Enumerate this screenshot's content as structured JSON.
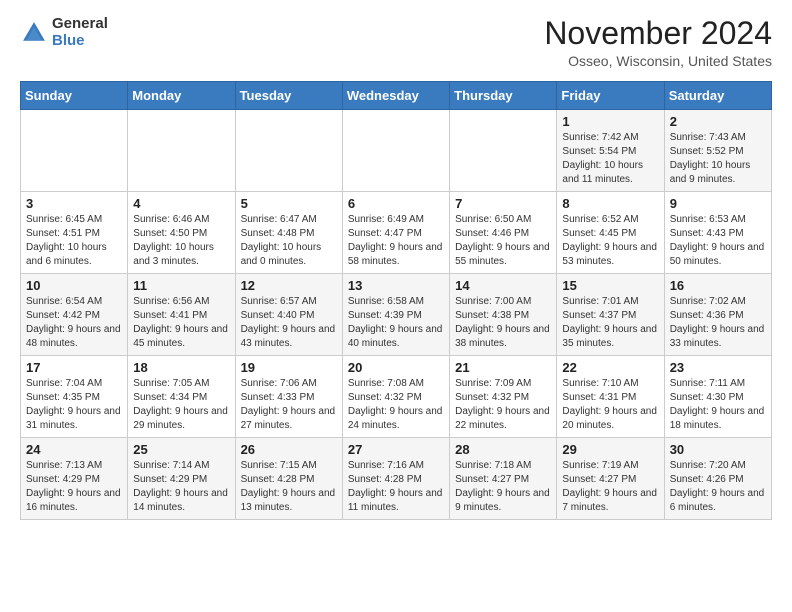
{
  "logo": {
    "general": "General",
    "blue": "Blue"
  },
  "title": "November 2024",
  "location": "Osseo, Wisconsin, United States",
  "days_of_week": [
    "Sunday",
    "Monday",
    "Tuesday",
    "Wednesday",
    "Thursday",
    "Friday",
    "Saturday"
  ],
  "weeks": [
    [
      {
        "day": "",
        "info": ""
      },
      {
        "day": "",
        "info": ""
      },
      {
        "day": "",
        "info": ""
      },
      {
        "day": "",
        "info": ""
      },
      {
        "day": "",
        "info": ""
      },
      {
        "day": "1",
        "info": "Sunrise: 7:42 AM\nSunset: 5:54 PM\nDaylight: 10 hours and 11 minutes."
      },
      {
        "day": "2",
        "info": "Sunrise: 7:43 AM\nSunset: 5:52 PM\nDaylight: 10 hours and 9 minutes."
      }
    ],
    [
      {
        "day": "3",
        "info": "Sunrise: 6:45 AM\nSunset: 4:51 PM\nDaylight: 10 hours and 6 minutes."
      },
      {
        "day": "4",
        "info": "Sunrise: 6:46 AM\nSunset: 4:50 PM\nDaylight: 10 hours and 3 minutes."
      },
      {
        "day": "5",
        "info": "Sunrise: 6:47 AM\nSunset: 4:48 PM\nDaylight: 10 hours and 0 minutes."
      },
      {
        "day": "6",
        "info": "Sunrise: 6:49 AM\nSunset: 4:47 PM\nDaylight: 9 hours and 58 minutes."
      },
      {
        "day": "7",
        "info": "Sunrise: 6:50 AM\nSunset: 4:46 PM\nDaylight: 9 hours and 55 minutes."
      },
      {
        "day": "8",
        "info": "Sunrise: 6:52 AM\nSunset: 4:45 PM\nDaylight: 9 hours and 53 minutes."
      },
      {
        "day": "9",
        "info": "Sunrise: 6:53 AM\nSunset: 4:43 PM\nDaylight: 9 hours and 50 minutes."
      }
    ],
    [
      {
        "day": "10",
        "info": "Sunrise: 6:54 AM\nSunset: 4:42 PM\nDaylight: 9 hours and 48 minutes."
      },
      {
        "day": "11",
        "info": "Sunrise: 6:56 AM\nSunset: 4:41 PM\nDaylight: 9 hours and 45 minutes."
      },
      {
        "day": "12",
        "info": "Sunrise: 6:57 AM\nSunset: 4:40 PM\nDaylight: 9 hours and 43 minutes."
      },
      {
        "day": "13",
        "info": "Sunrise: 6:58 AM\nSunset: 4:39 PM\nDaylight: 9 hours and 40 minutes."
      },
      {
        "day": "14",
        "info": "Sunrise: 7:00 AM\nSunset: 4:38 PM\nDaylight: 9 hours and 38 minutes."
      },
      {
        "day": "15",
        "info": "Sunrise: 7:01 AM\nSunset: 4:37 PM\nDaylight: 9 hours and 35 minutes."
      },
      {
        "day": "16",
        "info": "Sunrise: 7:02 AM\nSunset: 4:36 PM\nDaylight: 9 hours and 33 minutes."
      }
    ],
    [
      {
        "day": "17",
        "info": "Sunrise: 7:04 AM\nSunset: 4:35 PM\nDaylight: 9 hours and 31 minutes."
      },
      {
        "day": "18",
        "info": "Sunrise: 7:05 AM\nSunset: 4:34 PM\nDaylight: 9 hours and 29 minutes."
      },
      {
        "day": "19",
        "info": "Sunrise: 7:06 AM\nSunset: 4:33 PM\nDaylight: 9 hours and 27 minutes."
      },
      {
        "day": "20",
        "info": "Sunrise: 7:08 AM\nSunset: 4:32 PM\nDaylight: 9 hours and 24 minutes."
      },
      {
        "day": "21",
        "info": "Sunrise: 7:09 AM\nSunset: 4:32 PM\nDaylight: 9 hours and 22 minutes."
      },
      {
        "day": "22",
        "info": "Sunrise: 7:10 AM\nSunset: 4:31 PM\nDaylight: 9 hours and 20 minutes."
      },
      {
        "day": "23",
        "info": "Sunrise: 7:11 AM\nSunset: 4:30 PM\nDaylight: 9 hours and 18 minutes."
      }
    ],
    [
      {
        "day": "24",
        "info": "Sunrise: 7:13 AM\nSunset: 4:29 PM\nDaylight: 9 hours and 16 minutes."
      },
      {
        "day": "25",
        "info": "Sunrise: 7:14 AM\nSunset: 4:29 PM\nDaylight: 9 hours and 14 minutes."
      },
      {
        "day": "26",
        "info": "Sunrise: 7:15 AM\nSunset: 4:28 PM\nDaylight: 9 hours and 13 minutes."
      },
      {
        "day": "27",
        "info": "Sunrise: 7:16 AM\nSunset: 4:28 PM\nDaylight: 9 hours and 11 minutes."
      },
      {
        "day": "28",
        "info": "Sunrise: 7:18 AM\nSunset: 4:27 PM\nDaylight: 9 hours and 9 minutes."
      },
      {
        "day": "29",
        "info": "Sunrise: 7:19 AM\nSunset: 4:27 PM\nDaylight: 9 hours and 7 minutes."
      },
      {
        "day": "30",
        "info": "Sunrise: 7:20 AM\nSunset: 4:26 PM\nDaylight: 9 hours and 6 minutes."
      }
    ]
  ]
}
